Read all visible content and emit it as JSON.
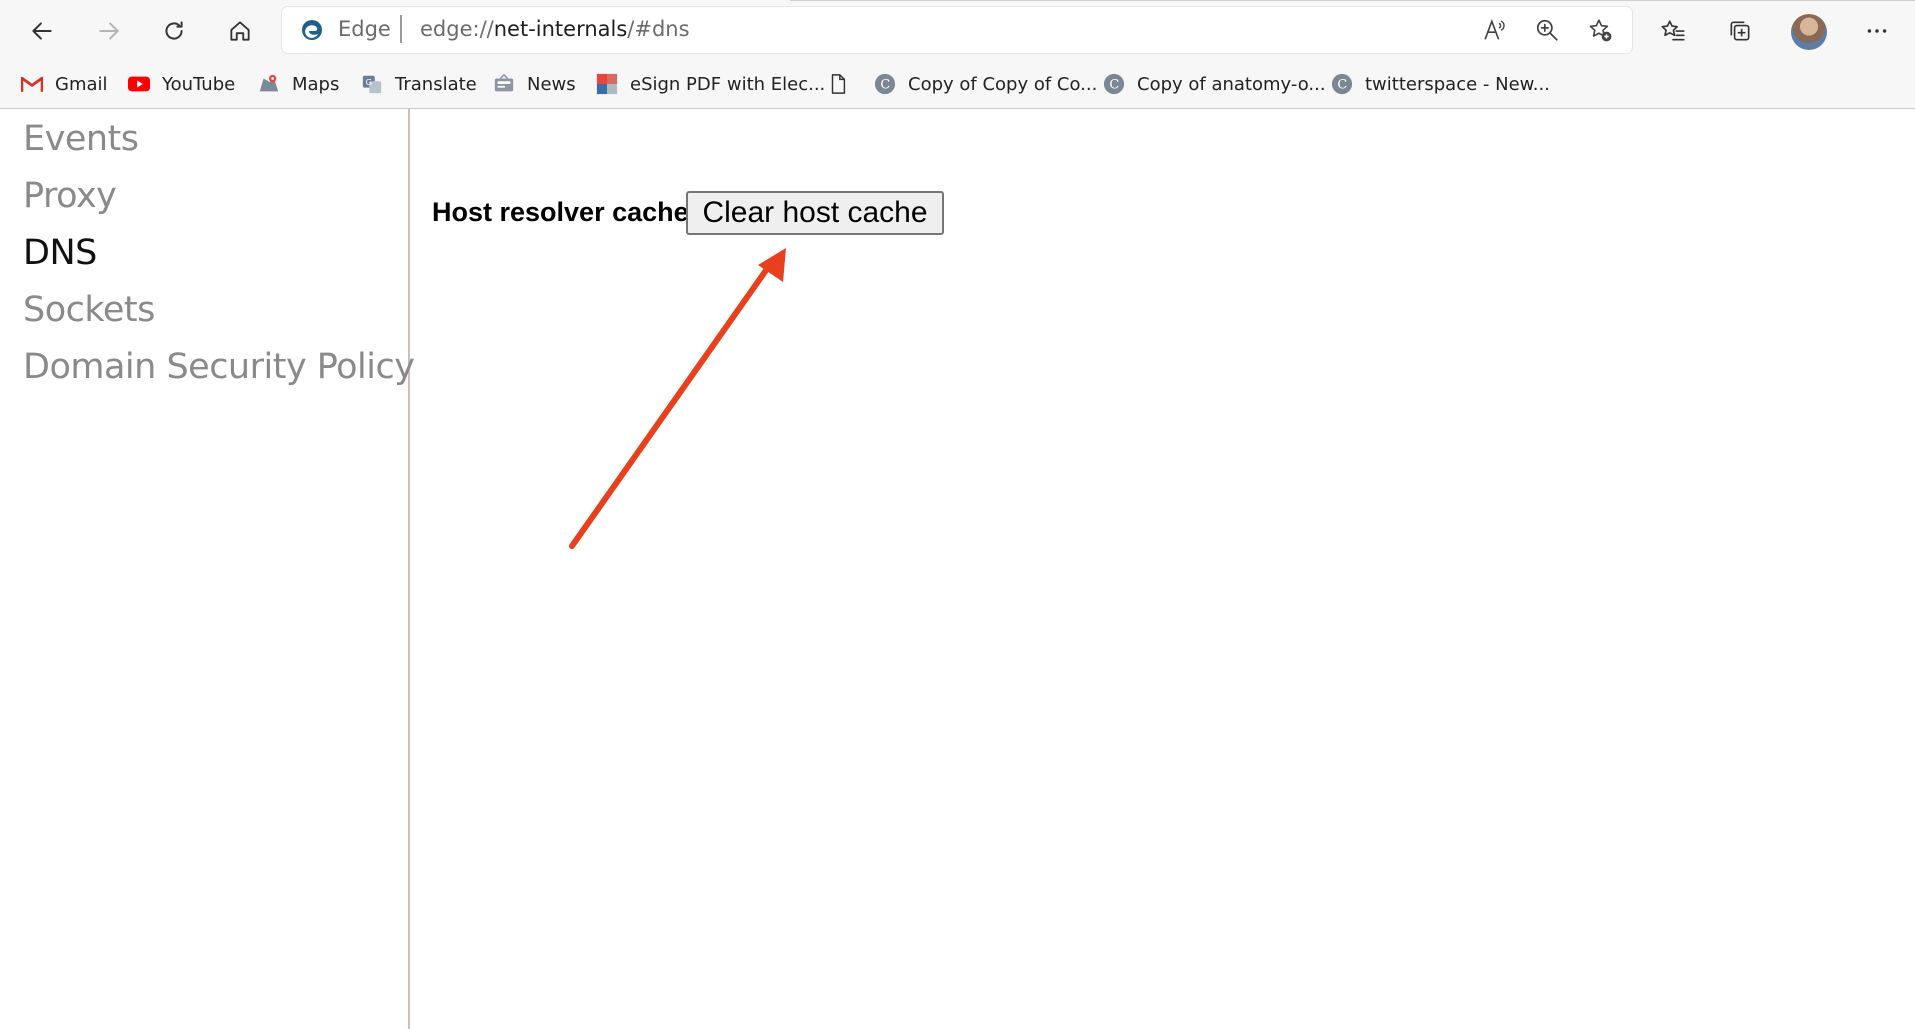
{
  "browser": {
    "address": {
      "site_label": "Edge",
      "url_scheme": "edge://",
      "url_host": "net-internals",
      "url_path": "/#dns"
    },
    "icons": {
      "back": "arrow-left-icon",
      "forward": "arrow-right-icon",
      "refresh": "refresh-icon",
      "home": "home-icon",
      "read_aloud": "read-aloud-icon",
      "zoom": "zoom-in-icon",
      "add_favorite": "add-favorite-icon",
      "favorites": "favorites-icon",
      "collections": "collections-icon",
      "profile": "avatar",
      "more": "more-icon"
    },
    "bookmarks": [
      {
        "label": "Gmail",
        "icon": "gmail-icon"
      },
      {
        "label": "YouTube",
        "icon": "youtube-icon"
      },
      {
        "label": "Maps",
        "icon": "maps-icon"
      },
      {
        "label": "Translate",
        "icon": "translate-icon"
      },
      {
        "label": "News",
        "icon": "news-icon"
      },
      {
        "label": "eSign PDF with Elec...",
        "icon": "esign-icon"
      },
      {
        "label": "",
        "icon": "document-icon"
      },
      {
        "label": "Copy of Copy of Co...",
        "icon": "c-logo-icon"
      },
      {
        "label": "Copy of anatomy-o...",
        "icon": "c-logo-icon"
      },
      {
        "label": "twitterspace - New...",
        "icon": "c-logo-icon"
      }
    ]
  },
  "sidebar": {
    "items": [
      {
        "label": "Events",
        "active": false
      },
      {
        "label": "Proxy",
        "active": false
      },
      {
        "label": "DNS",
        "active": true
      },
      {
        "label": "Sockets",
        "active": false
      },
      {
        "label": "Domain Security Policy",
        "active": false
      }
    ]
  },
  "main": {
    "host_resolver_label": "Host resolver cache",
    "clear_button_label": "Clear host cache"
  },
  "colors": {
    "annotation_arrow": "#e8401c",
    "gmail_red": "#d93025",
    "youtube_red": "#ff0000",
    "edge_blue": "#1f5f8b"
  }
}
